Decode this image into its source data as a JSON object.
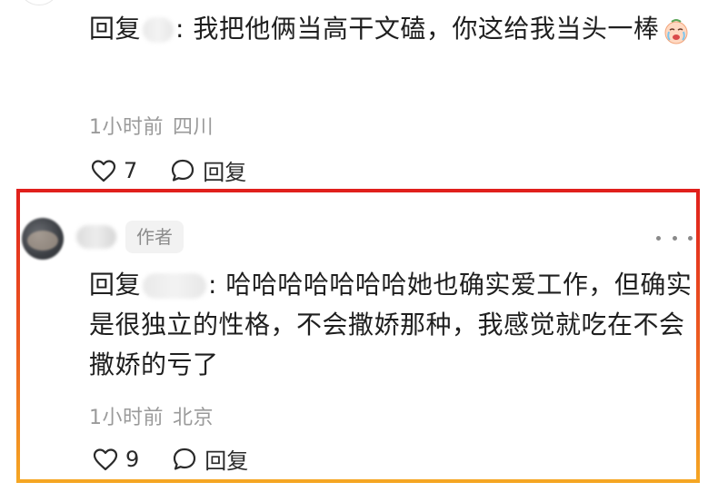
{
  "comment_prev": {
    "reply_prefix": "回复",
    "reply_text": ": 我把他俩当高干文磕，你这给我当头一棒",
    "emoji_name": "crying-face-icon",
    "time": "1小时前",
    "location": "四川",
    "likes": "7",
    "reply_label": "回复"
  },
  "comment_author": {
    "badge": "作者",
    "reply_prefix": "回复",
    "reply_text": ": 哈哈哈哈哈哈哈她也确实爱工作，但确实是很独立的性格，不会撒娇那种，我感觉就吃在不会撒娇的亏了",
    "time": "1小时前",
    "location": "北京",
    "likes": "9",
    "reply_label": "回复"
  },
  "colors": {
    "highlight_top": "#e0201c",
    "highlight_bottom": "#f5a623",
    "meta_gray": "#9a9a9a"
  }
}
